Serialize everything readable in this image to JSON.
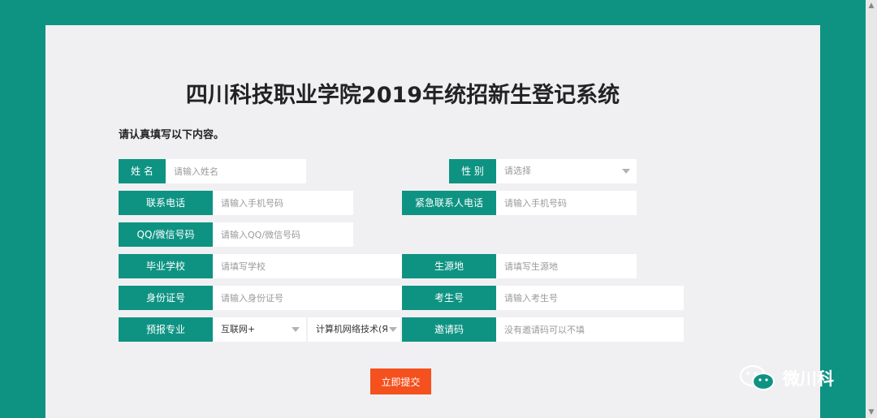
{
  "colors": {
    "teal": "#0e9383",
    "submit": "#f4511e"
  },
  "page_title": "四川科技职业学院2019年统招新生登记系统",
  "instruction": "请认真填写以下内容。",
  "form": {
    "name": {
      "label": "姓 名",
      "placeholder": "请输入姓名"
    },
    "gender": {
      "label": "性 别",
      "value": "请选择"
    },
    "phone": {
      "label": "联系电话",
      "placeholder": "请输入手机号码"
    },
    "emergency_phone": {
      "label": "紧急联系人电话",
      "placeholder": "请输入手机号码"
    },
    "qq_wechat": {
      "label": "QQ/微信号码",
      "placeholder": "请输入QQ/微信号码"
    },
    "school": {
      "label": "毕业学校",
      "placeholder": "请填写学校"
    },
    "origin": {
      "label": "生源地",
      "placeholder": "请填写生源地"
    },
    "id_number": {
      "label": "身份证号",
      "placeholder": "请输入身份证号"
    },
    "exam_number": {
      "label": "考生号",
      "placeholder": "请输入考生号"
    },
    "major": {
      "label": "预报专业",
      "category": "互联网+",
      "specialty": "计算机网络技术(Я"
    },
    "invite_code": {
      "label": "邀请码",
      "placeholder": "没有邀请码可以不填"
    }
  },
  "submit_label": "立即提交",
  "watermark": {
    "text": "微川科",
    "icon": "wechat-icon"
  }
}
